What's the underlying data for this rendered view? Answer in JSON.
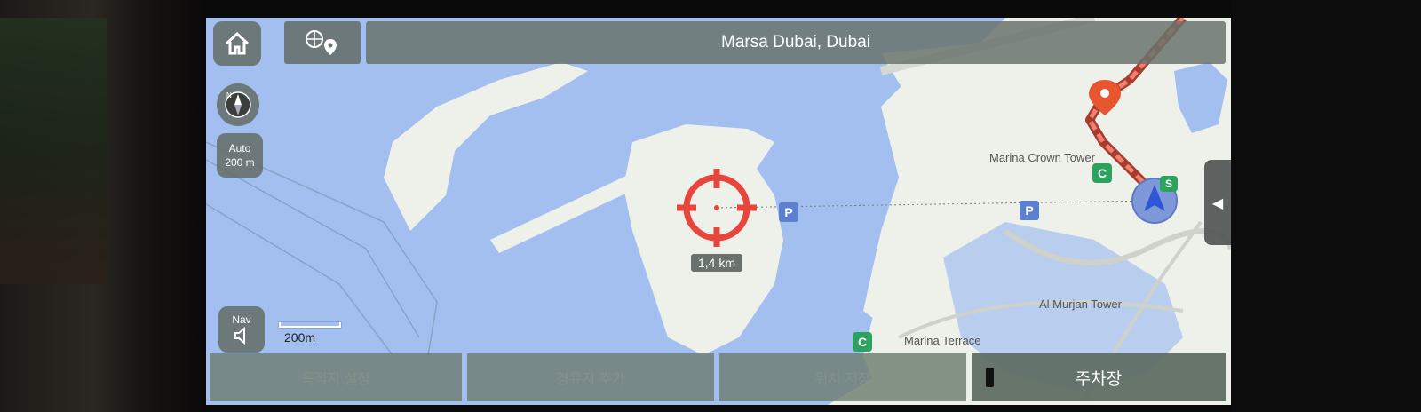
{
  "header": {
    "title": "Marsa Dubai, Dubai"
  },
  "left_controls": {
    "compass_label": "N",
    "zoom_mode": "Auto",
    "zoom_scale": "200 m",
    "nav_label": "Nav",
    "scale_bar_label": "200m"
  },
  "map": {
    "distance_label": "1,4 km",
    "places": [
      "Marina Crown Tower",
      "Al Murjan Tower",
      "Marina Terrace"
    ],
    "parking_glyph": "P",
    "poi_glyph": "C",
    "route_badge": "S"
  },
  "bottom_menu": {
    "set_destination": "목적지 설정",
    "add_waypoint": "경유지 추가",
    "save_location": "위치 저장",
    "parking": "주차장"
  },
  "colors": {
    "water": "#a3bff0",
    "land": "#eef0ea",
    "route": "#e85a44",
    "crosshair": "#e8453c",
    "panel": "#6a736c"
  },
  "icons": [
    "home-icon",
    "search-location-icon",
    "compass-icon",
    "speaker-icon",
    "crosshair-icon",
    "destination-pin-icon",
    "vehicle-position-icon",
    "chevron-left-icon"
  ]
}
